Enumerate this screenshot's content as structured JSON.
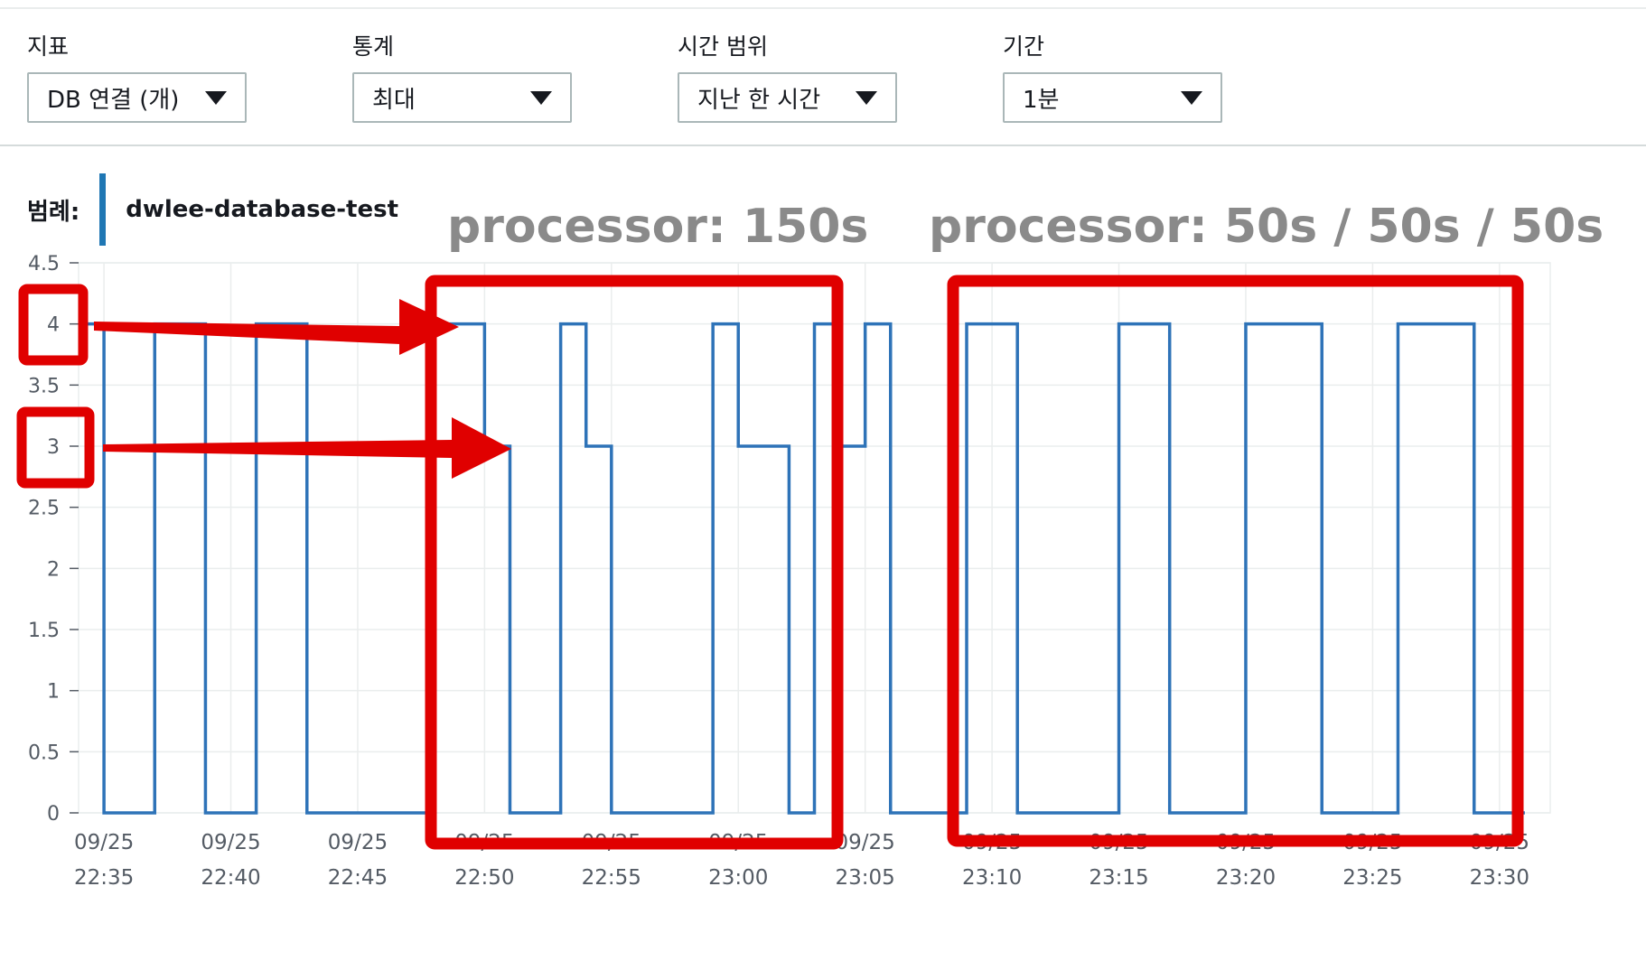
{
  "controls": {
    "metric": {
      "label": "지표",
      "value": "DB 연결 (개)"
    },
    "statistic": {
      "label": "통계",
      "value": "최대"
    },
    "time_range": {
      "label": "시간 범위",
      "value": "지난 한 시간"
    },
    "period": {
      "label": "기간",
      "value": "1분"
    }
  },
  "legend": {
    "label": "범례:",
    "series_name": "dwlee-database-test"
  },
  "annotations": {
    "left_title": "processor: 150s",
    "right_title": "processor: 50s / 50s / 50s"
  },
  "colors": {
    "line": "#2e73b8",
    "annotation": "#e00000",
    "grid": "#eaeded",
    "annotation_text": "#8a8a8a"
  },
  "chart_data": {
    "type": "line",
    "step": true,
    "xlabel": "",
    "ylabel": "",
    "ylim": [
      0,
      4.5
    ],
    "yticks": [
      "0",
      "0.5",
      "1",
      "1.5",
      "2",
      "2.5",
      "3",
      "3.5",
      "4",
      "4.5"
    ],
    "xticks": [
      {
        "date": "09/25",
        "time": "22:35"
      },
      {
        "date": "09/25",
        "time": "22:40"
      },
      {
        "date": "09/25",
        "time": "22:45"
      },
      {
        "date": "09/25",
        "time": "22:50"
      },
      {
        "date": "09/25",
        "time": "22:55"
      },
      {
        "date": "09/25",
        "time": "23:00"
      },
      {
        "date": "09/25",
        "time": "23:05"
      },
      {
        "date": "09/25",
        "time": "23:10"
      },
      {
        "date": "09/25",
        "time": "23:15"
      },
      {
        "date": "09/25",
        "time": "23:20"
      },
      {
        "date": "09/25",
        "time": "23:25"
      },
      {
        "date": "09/25",
        "time": "23:30"
      }
    ],
    "xlim": [
      "22:34",
      "23:32"
    ],
    "grid": true,
    "legend_position": "top-left",
    "series": [
      {
        "name": "dwlee-database-test",
        "points": [
          [
            "22:34",
            4
          ],
          [
            "22:35",
            0
          ],
          [
            "22:37",
            4
          ],
          [
            "22:39",
            0
          ],
          [
            "22:41",
            4
          ],
          [
            "22:43",
            0
          ],
          [
            "22:48",
            4
          ],
          [
            "22:50",
            3
          ],
          [
            "22:51",
            0
          ],
          [
            "22:53",
            4
          ],
          [
            "22:54",
            3
          ],
          [
            "22:55",
            0
          ],
          [
            "22:59",
            4
          ],
          [
            "23:00",
            3
          ],
          [
            "23:02",
            0
          ],
          [
            "23:03",
            4
          ],
          [
            "23:04",
            3
          ],
          [
            "23:05",
            4
          ],
          [
            "23:06",
            0
          ],
          [
            "23:09",
            4
          ],
          [
            "23:11",
            0
          ],
          [
            "23:15",
            4
          ],
          [
            "23:17",
            0
          ],
          [
            "23:20",
            4
          ],
          [
            "23:23",
            0
          ],
          [
            "23:26",
            4
          ],
          [
            "23:29",
            0
          ],
          [
            "23:31",
            0
          ]
        ]
      }
    ],
    "highlight_labels": [
      "4",
      "3"
    ]
  }
}
